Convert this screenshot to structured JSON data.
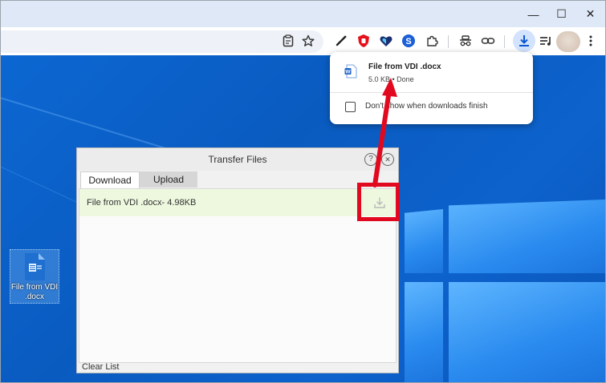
{
  "browser": {
    "window_controls": {
      "minimize": "—",
      "maximize": "☐",
      "close": "✕"
    }
  },
  "toolbar": {
    "icons": [
      "clipboard-icon",
      "star-icon",
      "pen-icon",
      "ublock-icon",
      "heart-shield-icon",
      "s-extension-icon",
      "puzzle-icon",
      "incognito-icon",
      "link-icon",
      "download-icon",
      "media-queue-icon",
      "avatar",
      "more-icon"
    ]
  },
  "download_popup": {
    "filename": "File from VDI .docx",
    "status": "5.0 KB • Done",
    "checkbox_label": "Don't show when downloads finish"
  },
  "transfer_dialog": {
    "title": "Transfer Files",
    "help_glyph": "?",
    "close_glyph": "✕",
    "tabs": [
      {
        "label": "Download",
        "active": true
      },
      {
        "label": "Upload",
        "active": false
      }
    ],
    "files": [
      {
        "text": "File from VDI .docx- 4.98KB"
      }
    ],
    "clear_label": "Clear List"
  },
  "desktop_icon": {
    "label_line1": "File from VDI",
    "label_line2": ".docx"
  },
  "colors": {
    "annotation_red": "#e1091f",
    "desktop_blue": "#0a62c9",
    "row_highlight": "#eef8df",
    "download_active_bg": "#d3e3fd"
  }
}
